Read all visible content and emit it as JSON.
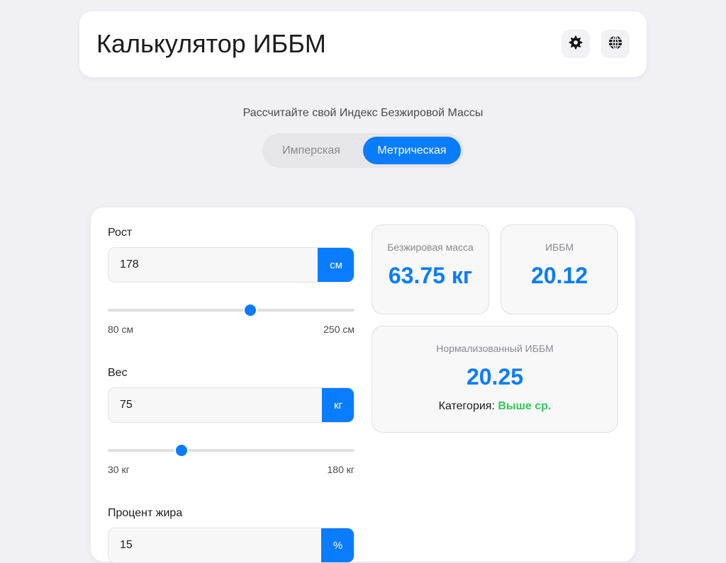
{
  "header": {
    "title": "Калькулятор ИББМ",
    "theme_icon": "sun-gear-icon",
    "language_icon": "globe-icon"
  },
  "subtitle": "Рассчитайте свой Индекс Безжировой Массы",
  "units_toggle": {
    "options": [
      "Имперская",
      "Метрическая"
    ],
    "selected": "Метрическая"
  },
  "form": {
    "height": {
      "label": "Рост",
      "value": "178",
      "unit": "см",
      "slider_value": 178,
      "min": 80,
      "max": 250,
      "min_label": "80 см",
      "max_label": "250 см"
    },
    "weight": {
      "label": "Вес",
      "value": "75",
      "unit": "кг",
      "slider_value": 75,
      "min": 30,
      "max": 180,
      "min_label": "30 кг",
      "max_label": "180 кг"
    },
    "bodyfat": {
      "label": "Процент жира",
      "value": "15",
      "unit": "%"
    }
  },
  "results": {
    "lean_mass": {
      "label": "Безжировая масса",
      "value": "63.75 кг"
    },
    "ffmi": {
      "label": "ИББМ",
      "value": "20.12"
    },
    "normalized": {
      "label": "Нормализованный ИББМ",
      "value": "20.25",
      "category_label": "Категория:",
      "category_value": "Выше ср."
    }
  },
  "colors": {
    "accent": "#0a7cff",
    "category": "#34c759",
    "background": "#f0f0f5"
  }
}
